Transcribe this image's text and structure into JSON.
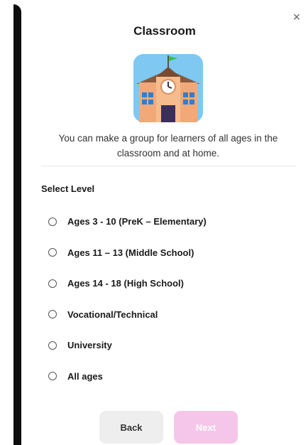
{
  "modal": {
    "title": "Classroom",
    "close_symbol": "×",
    "description": "You can make a group for learners of all ages in the classroom and at home.",
    "section_label": "Select Level",
    "options": [
      {
        "label": "Ages 3 - 10 (PreK – Elementary)",
        "selected": false
      },
      {
        "label": "Ages 11 – 13 (Middle School)",
        "selected": false
      },
      {
        "label": "Ages 14 - 18 (High School)",
        "selected": false
      },
      {
        "label": "Vocational/Technical",
        "selected": false
      },
      {
        "label": "University",
        "selected": false
      },
      {
        "label": "All ages",
        "selected": false
      }
    ],
    "buttons": {
      "back_label": "Back",
      "next_label": "Next",
      "next_enabled": false
    }
  },
  "illustration": {
    "icon": "school-building-icon"
  },
  "colors": {
    "next_disabled": "#f5c6ea",
    "back_bg": "#eeeeee",
    "text": "#1a1a1a"
  }
}
